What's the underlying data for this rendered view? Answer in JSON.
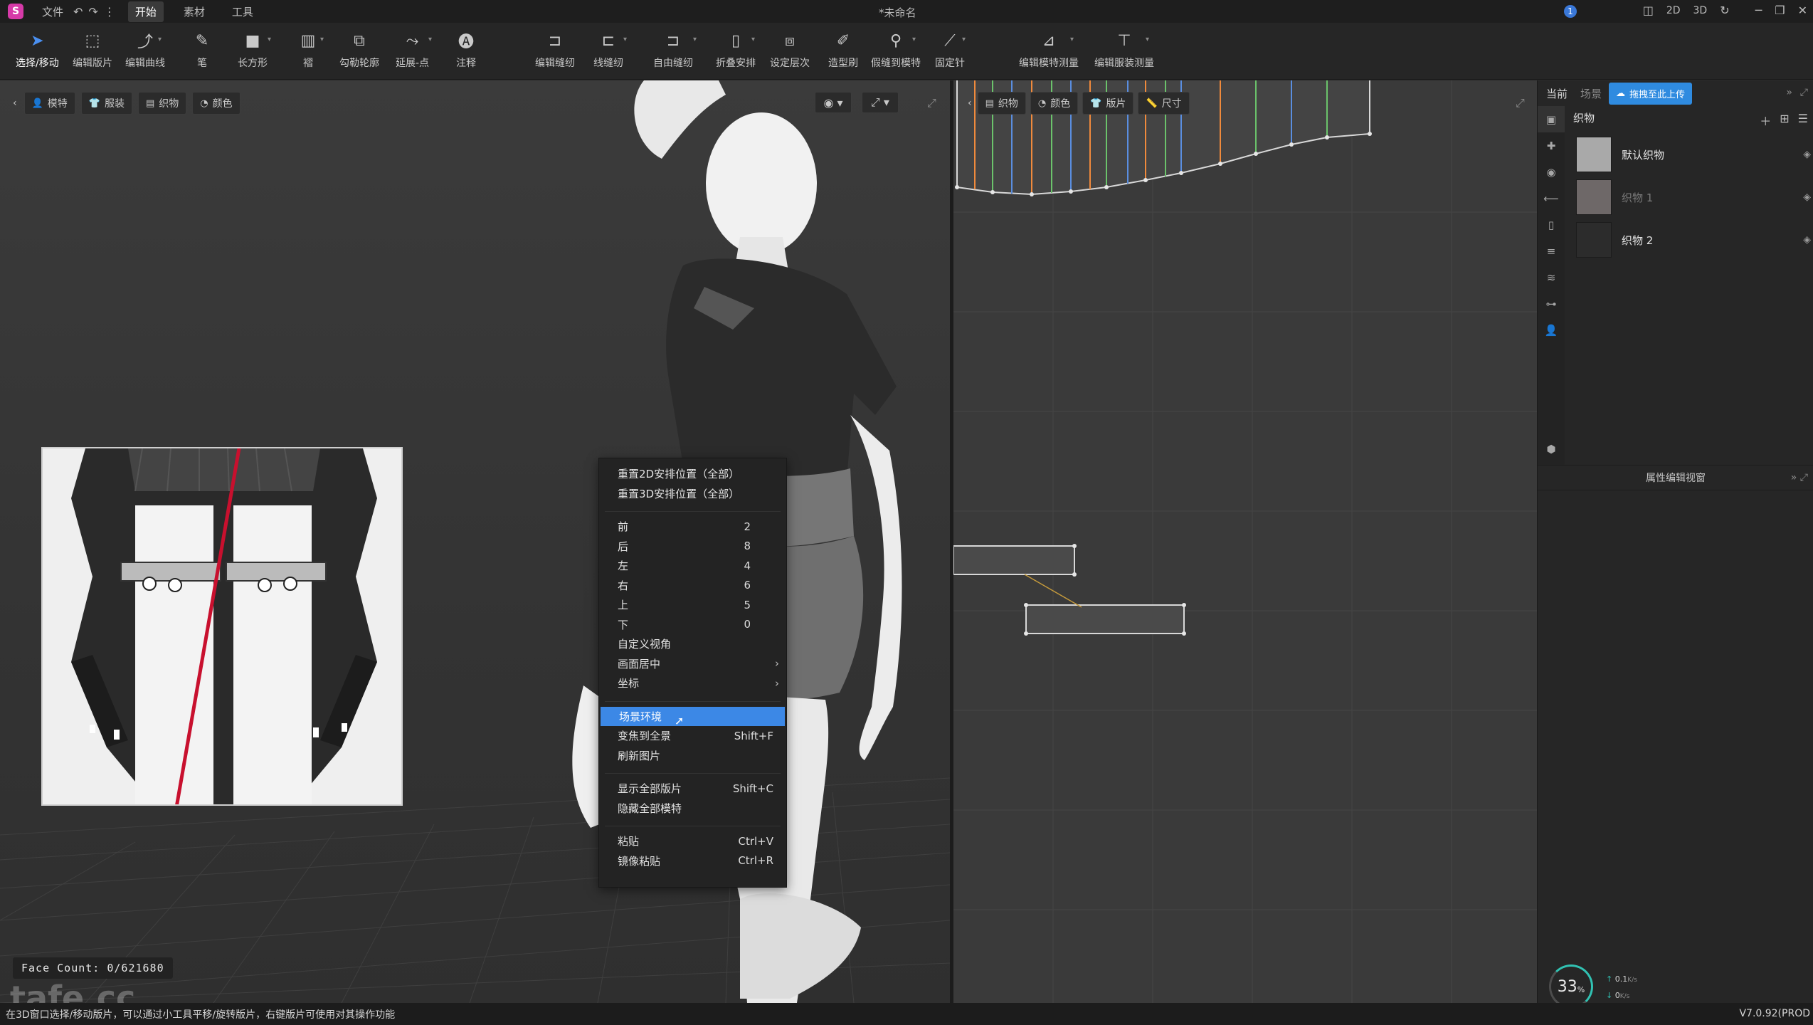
{
  "app": {
    "logo": "S",
    "doc_title": "*未命名",
    "menu": [
      "文件"
    ],
    "tabs": [
      "开始",
      "素材",
      "工具"
    ],
    "info_badge": "1",
    "view_modes": [
      "2D",
      "3D"
    ]
  },
  "toolbar": {
    "tools": [
      {
        "label": "选择/移动",
        "icon": "select-arrow-icon"
      },
      {
        "label": "编辑版片",
        "icon": "edit-pattern-icon"
      },
      {
        "label": "编辑曲线",
        "icon": "edit-curve-icon"
      },
      {
        "label": "笔",
        "icon": "pen-icon"
      },
      {
        "label": "长方形",
        "icon": "rectangle-icon"
      },
      {
        "label": "褶",
        "icon": "pleat-icon"
      },
      {
        "label": "勾勒轮廓",
        "icon": "trace-outline-icon"
      },
      {
        "label": "延展-点",
        "icon": "extend-point-icon"
      },
      {
        "label": "注释",
        "icon": "annotation-icon"
      },
      {
        "label": "编辑缝纫",
        "icon": "edit-sewing-icon"
      },
      {
        "label": "线缝纫",
        "icon": "segment-sewing-icon"
      },
      {
        "label": "自由缝纫",
        "icon": "free-sewing-icon"
      },
      {
        "label": "折叠安排",
        "icon": "fold-arrange-icon"
      },
      {
        "label": "设定层次",
        "icon": "set-layer-icon"
      },
      {
        "label": "造型刷",
        "icon": "shape-brush-icon"
      },
      {
        "label": "假缝到模特",
        "icon": "tack-on-avatar-icon"
      },
      {
        "label": "固定针",
        "icon": "pin-icon"
      },
      {
        "label": "编辑模特测量",
        "icon": "avatar-measure-icon"
      },
      {
        "label": "编辑服装测量",
        "icon": "garment-measure-icon"
      }
    ]
  },
  "viewport3d": {
    "buttons": [
      "模特",
      "服装",
      "织物",
      "颜色"
    ],
    "face_count": "Face Count: 0/621680",
    "watermark": "tafe.cc"
  },
  "context_menu": {
    "items": [
      {
        "label": "重置2D安排位置（全部）",
        "shortcut": ""
      },
      {
        "label": "重置3D安排位置（全部）",
        "shortcut": ""
      },
      {
        "label": "前",
        "shortcut": "2"
      },
      {
        "label": "后",
        "shortcut": "8"
      },
      {
        "label": "左",
        "shortcut": "4"
      },
      {
        "label": "右",
        "shortcut": "6"
      },
      {
        "label": "上",
        "shortcut": "5"
      },
      {
        "label": "下",
        "shortcut": "0"
      },
      {
        "label": "自定义视角",
        "shortcut": ""
      },
      {
        "label": "画面居中",
        "shortcut": ""
      },
      {
        "label": "坐标",
        "shortcut": ""
      },
      {
        "label": "场景环境",
        "shortcut": ""
      },
      {
        "label": "变焦到全景",
        "shortcut": "Shift+F"
      },
      {
        "label": "刷新图片",
        "shortcut": ""
      },
      {
        "label": "显示全部版片",
        "shortcut": "Shift+C"
      },
      {
        "label": "隐藏全部模特",
        "shortcut": ""
      },
      {
        "label": "粘贴",
        "shortcut": "Ctrl+V"
      },
      {
        "label": "镜像粘贴",
        "shortcut": "Ctrl+R"
      }
    ],
    "highlighted": "场景环境"
  },
  "viewport2d": {
    "buttons": [
      "织物",
      "颜色",
      "版片",
      "尺寸"
    ]
  },
  "right_panel": {
    "tabs": [
      "当前",
      "场景"
    ],
    "upload_label": "拖拽至此上传",
    "section_title": "织物",
    "fabrics": [
      {
        "name": "默认织物",
        "color": "#a9a9a9"
      },
      {
        "name": "织物 1",
        "color": "#6e6868"
      },
      {
        "name": "织物 2",
        "color": "#2c2c2c"
      }
    ],
    "property_header": "属性编辑视窗",
    "perf_percent": "33",
    "perf_unit": "%",
    "net_up": "0.1",
    "net_up_unit": "K/s",
    "net_down": "0",
    "net_down_unit": "K/s"
  },
  "status": {
    "text": "在3D窗口选择/移动版片，可以通过小工具平移/旋转版片，右键版片可使用对其操作功能",
    "version": "V7.0.92(PROD"
  },
  "colors": {
    "accent": "#3c88e6",
    "upload": "#2f8be0",
    "seam_red": "#c8102e"
  }
}
